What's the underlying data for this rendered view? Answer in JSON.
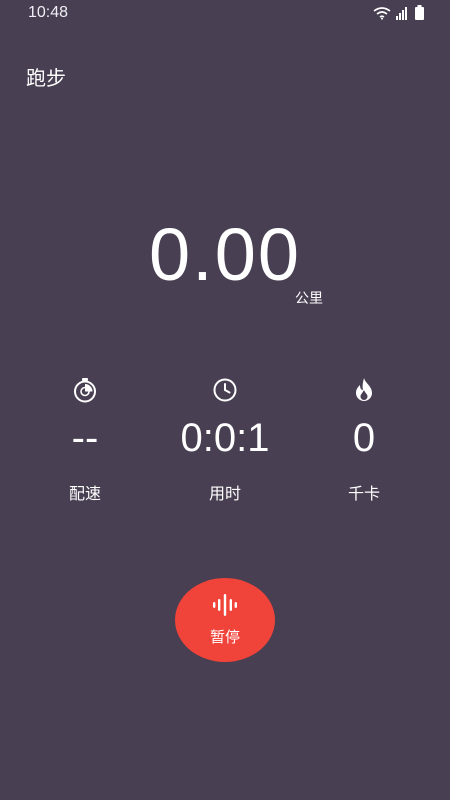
{
  "status_bar": {
    "time": "10:48",
    "icons": [
      "wifi-icon",
      "signal-icon",
      "battery-icon"
    ]
  },
  "header": {
    "title": "跑步"
  },
  "distance": {
    "value": "0.00",
    "unit": "公里"
  },
  "stats": [
    {
      "icon": "stopwatch-icon",
      "value": "--",
      "label": "配速"
    },
    {
      "icon": "clock-icon",
      "value": "0:0:1",
      "label": "用时"
    },
    {
      "icon": "flame-icon",
      "value": "0",
      "label": "千卡"
    }
  ],
  "pause_button": {
    "icon": "voice-wave-icon",
    "label": "暂停"
  },
  "colors": {
    "background": "#483f52",
    "accent": "#f0433a",
    "text": "#ffffff"
  }
}
